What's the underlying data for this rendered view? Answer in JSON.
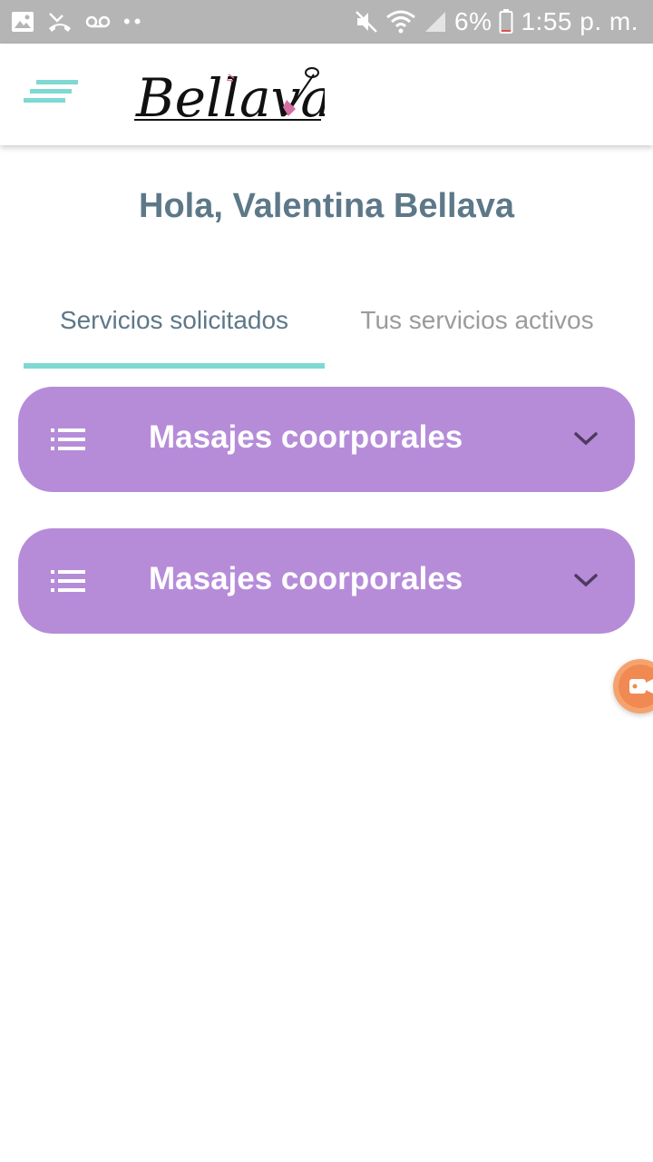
{
  "status_bar": {
    "left_icons": [
      "gallery-icon",
      "missed-call-icon",
      "voicemail-icon"
    ],
    "dots": "••",
    "right_icons": [
      "mute-icon",
      "wifi-icon",
      "signal-icon",
      "battery-icon"
    ],
    "battery": "6%",
    "time": "1:55 p. m."
  },
  "app_bar": {
    "menu_icon": "hamburger-menu-icon",
    "logo_text": "Bellava",
    "accent_color": "#7fd8d2"
  },
  "greeting": "Hola, Valentina Bellava",
  "tabs": [
    {
      "label": "Servicios solicitados",
      "active": true
    },
    {
      "label": "Tus servicios activos",
      "active": false
    }
  ],
  "services": [
    {
      "title": "Masajes coorporales",
      "icon": "list-icon",
      "expand_icon": "chevron-down-icon"
    },
    {
      "title": "Masajes coorporales",
      "icon": "list-icon",
      "expand_icon": "chevron-down-icon"
    }
  ],
  "colors": {
    "card": "#b68cd9",
    "greeting": "#5d7888",
    "tab_inactive": "#9b9b9b",
    "status_bar": "#b5b5b5",
    "fab": "#f5a36e"
  },
  "floating_button": {
    "icon": "screen-recorder-icon"
  }
}
